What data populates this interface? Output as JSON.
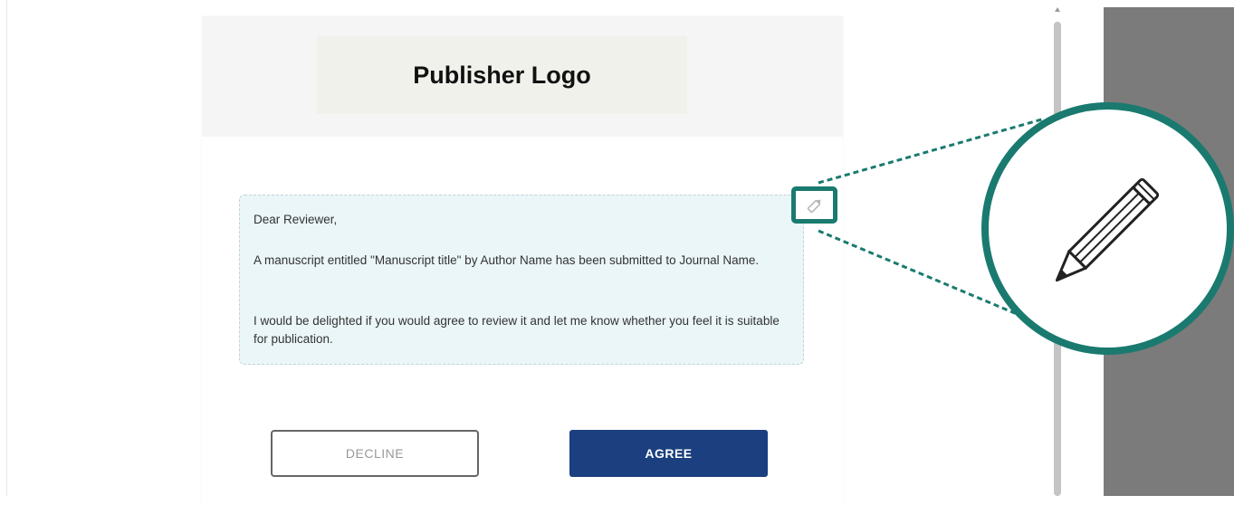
{
  "header": {
    "logo_text": "Publisher Logo"
  },
  "message": {
    "greeting": "Dear Reviewer,",
    "paragraph1": "A manuscript entitled \"Manuscript title\" by Author Name has been submitted to Journal Name.",
    "paragraph2": "I would be delighted if you would agree to review it and let me know whether you feel it is suitable for publication."
  },
  "actions": {
    "decline_label": "DECLINE",
    "agree_label": "AGREE"
  },
  "icons": {
    "edit": "pencil-icon",
    "zoom": "pencil-icon-magnified",
    "scroll_up": "chevron-up-icon"
  },
  "colors": {
    "highlight": "#1a7a6f",
    "agree_button": "#1b3f7f",
    "message_background": "#ebf6f8",
    "side_panel": "#7b7b7b"
  }
}
